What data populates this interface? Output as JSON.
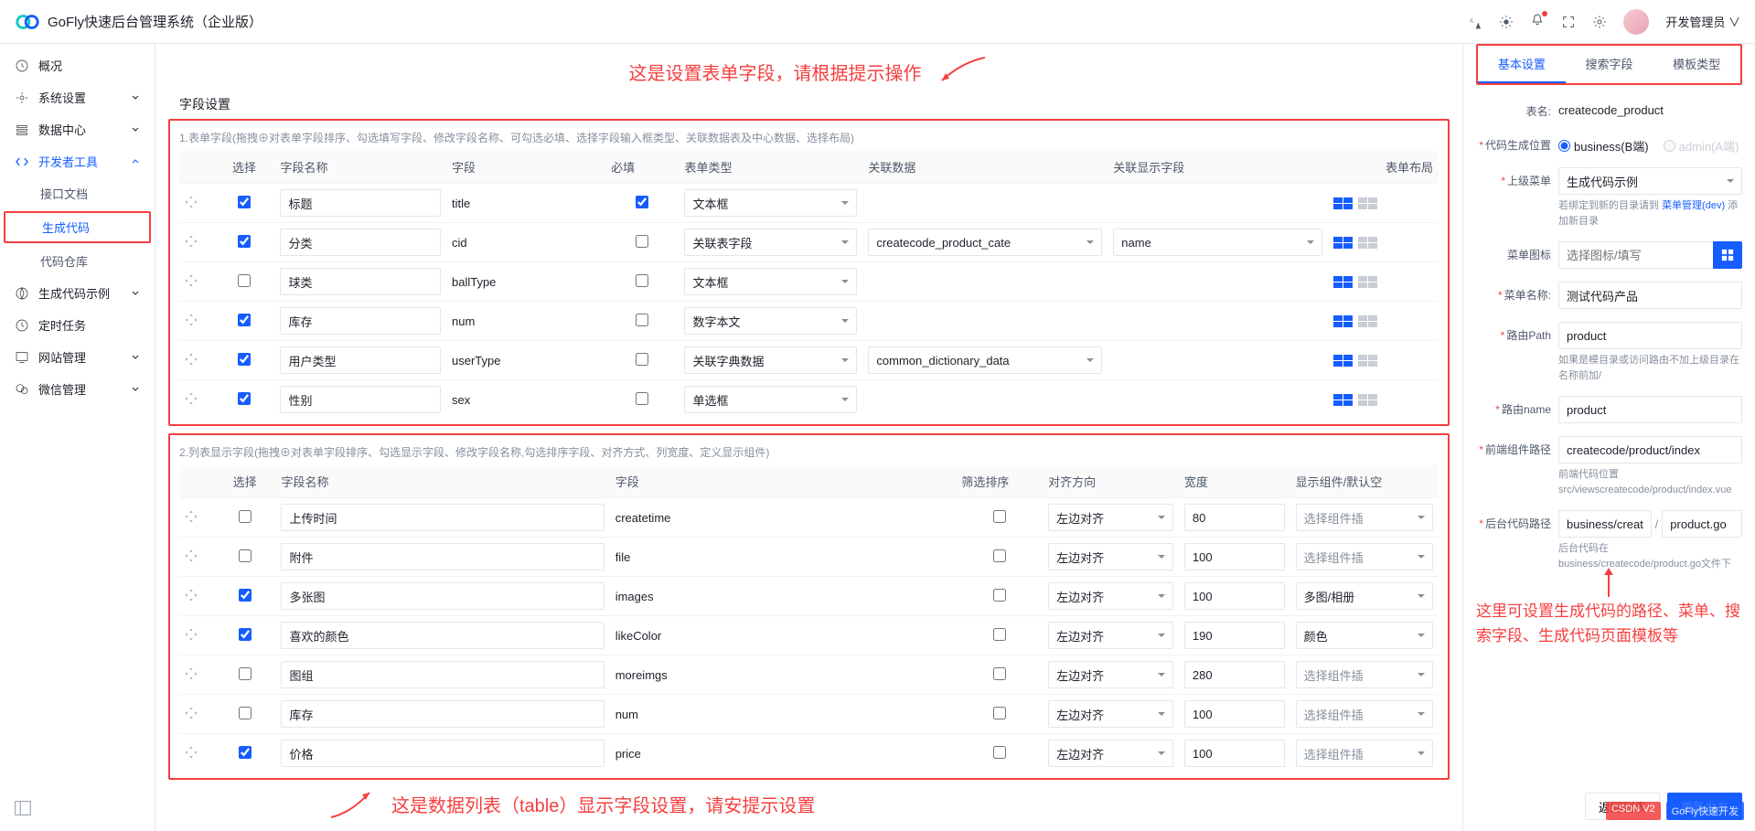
{
  "header": {
    "title": "GoFly快速后台管理系统（企业版）",
    "user": "开发管理员"
  },
  "annotations": {
    "top": "这是设置表单字段，请根据提示操作",
    "bottom": "这是数据列表（table）显示字段设置，请安提示设置",
    "right": "这里可设置生成代码的路径、菜单、搜索字段、生成代码页面模板等"
  },
  "sidebar": {
    "items": [
      {
        "label": "概况",
        "icon": "dashboard"
      },
      {
        "label": "系统设置",
        "icon": "gear",
        "chev": true
      },
      {
        "label": "数据中心",
        "icon": "list",
        "chev": true
      },
      {
        "label": "开发者工具",
        "icon": "code",
        "chev": true,
        "open": true
      },
      {
        "label": "接口文档",
        "child": true
      },
      {
        "label": "生成代码",
        "child": true,
        "active": true
      },
      {
        "label": "代码仓库",
        "child": true
      },
      {
        "label": "生成代码示例",
        "icon": "compass",
        "chev": true
      },
      {
        "label": "定时任务",
        "icon": "clock"
      },
      {
        "label": "网站管理",
        "icon": "monitor",
        "chev": true
      },
      {
        "label": "微信管理",
        "icon": "wechat",
        "chev": true
      }
    ]
  },
  "main": {
    "title": "字段设置",
    "section1_desc": "1.表单字段(拖拽⊕对表单字段排序、勾选填写字段、修改字段名称、可勾选必填、选择字段输入框类型、关联数据表及中心数据、选择布局)",
    "section2_desc": "2.列表显示字段(拖拽⊕对表单字段排序、勾选显示字段、修改字段名称,勾选排序字段、对齐方式、列宽度、定义显示组件)",
    "cols1": {
      "select": "选择",
      "name": "字段名称",
      "field": "字段",
      "required": "必填",
      "type": "表单类型",
      "rel": "关联数据",
      "reldisp": "关联显示字段",
      "layout": "表单布局"
    },
    "rows1": [
      {
        "sel": true,
        "name": "标题",
        "field": "title",
        "req": true,
        "type": "文本框",
        "rel": "",
        "reldisp": ""
      },
      {
        "sel": true,
        "name": "分类",
        "field": "cid",
        "req": false,
        "type": "关联表字段",
        "rel": "createcode_product_cate",
        "reldisp": "name"
      },
      {
        "sel": false,
        "name": "球类",
        "field": "ballType",
        "req": false,
        "type": "文本框",
        "rel": "",
        "reldisp": ""
      },
      {
        "sel": true,
        "name": "库存",
        "field": "num",
        "req": false,
        "type": "数字本文",
        "rel": "",
        "reldisp": ""
      },
      {
        "sel": true,
        "name": "用户类型",
        "field": "userType",
        "req": false,
        "type": "关联字典数据",
        "rel": "common_dictionary_data",
        "reldisp": ""
      },
      {
        "sel": true,
        "name": "性别",
        "field": "sex",
        "req": false,
        "type": "单选框",
        "rel": "",
        "reldisp": ""
      }
    ],
    "cols2": {
      "select": "选择",
      "name": "字段名称",
      "field": "字段",
      "sort": "筛选排序",
      "align": "对齐方向",
      "width": "宽度",
      "comp": "显示组件/默认空"
    },
    "comp_placeholder": "选择组件插",
    "rows2": [
      {
        "sel": false,
        "name": "上传时间",
        "field": "createtime",
        "sort": false,
        "align": "左边对齐",
        "width": "80",
        "comp": ""
      },
      {
        "sel": false,
        "name": "附件",
        "field": "file",
        "sort": false,
        "align": "左边对齐",
        "width": "100",
        "comp": ""
      },
      {
        "sel": true,
        "name": "多张图",
        "field": "images",
        "sort": false,
        "align": "左边对齐",
        "width": "100",
        "comp": "多图/相册"
      },
      {
        "sel": true,
        "name": "喜欢的颜色",
        "field": "likeColor",
        "sort": false,
        "align": "左边对齐",
        "width": "190",
        "comp": "颜色"
      },
      {
        "sel": false,
        "name": "图组",
        "field": "moreimgs",
        "sort": false,
        "align": "左边对齐",
        "width": "280",
        "comp": ""
      },
      {
        "sel": false,
        "name": "库存",
        "field": "num",
        "sort": false,
        "align": "左边对齐",
        "width": "100",
        "comp": ""
      },
      {
        "sel": true,
        "name": "价格",
        "field": "price",
        "sort": false,
        "align": "左边对齐",
        "width": "100",
        "comp": ""
      }
    ]
  },
  "right": {
    "tabs": [
      "基本设置",
      "搜索字段",
      "模板类型"
    ],
    "table_name_label": "表名:",
    "table_name": "createcode_product",
    "gen_loc_label": "代码生成位置",
    "gen_loc_opts": [
      "business(B端)",
      "admin(A端)"
    ],
    "parent_menu_label": "上级菜单",
    "parent_menu": "生成代码示例",
    "parent_hint_pre": "若绑定到新的目录请到 ",
    "parent_hint_link": "菜单管理(dev)",
    "parent_hint_post": " 添加新目录",
    "menu_icon_label": "菜单图标",
    "menu_icon_placeholder": "选择图标/填写",
    "menu_name_label": "菜单名称:",
    "menu_name": "测试代码产品",
    "route_path_label": "路由Path",
    "route_path": "product",
    "route_path_hint": "如果是模目录或访问路由不加上级目录在名称前加/",
    "route_name_label": "路由name",
    "route_name": "product",
    "fe_path_label": "前端组件路径",
    "fe_path": "createcode/product/index",
    "fe_hint": "前端代码位置 src/viewscreatecode/product/index.vue",
    "be_path_label": "后台代码路径",
    "be_path1": "business/createcc",
    "be_path2": "product.go",
    "be_hint": "后台代码在business/createcode/product.go文件下",
    "back_btn": "返回列表",
    "submit_btn": "更新发布"
  },
  "watermark": {
    "left": "CSDN V2",
    "right": "GoFly快速开发"
  }
}
